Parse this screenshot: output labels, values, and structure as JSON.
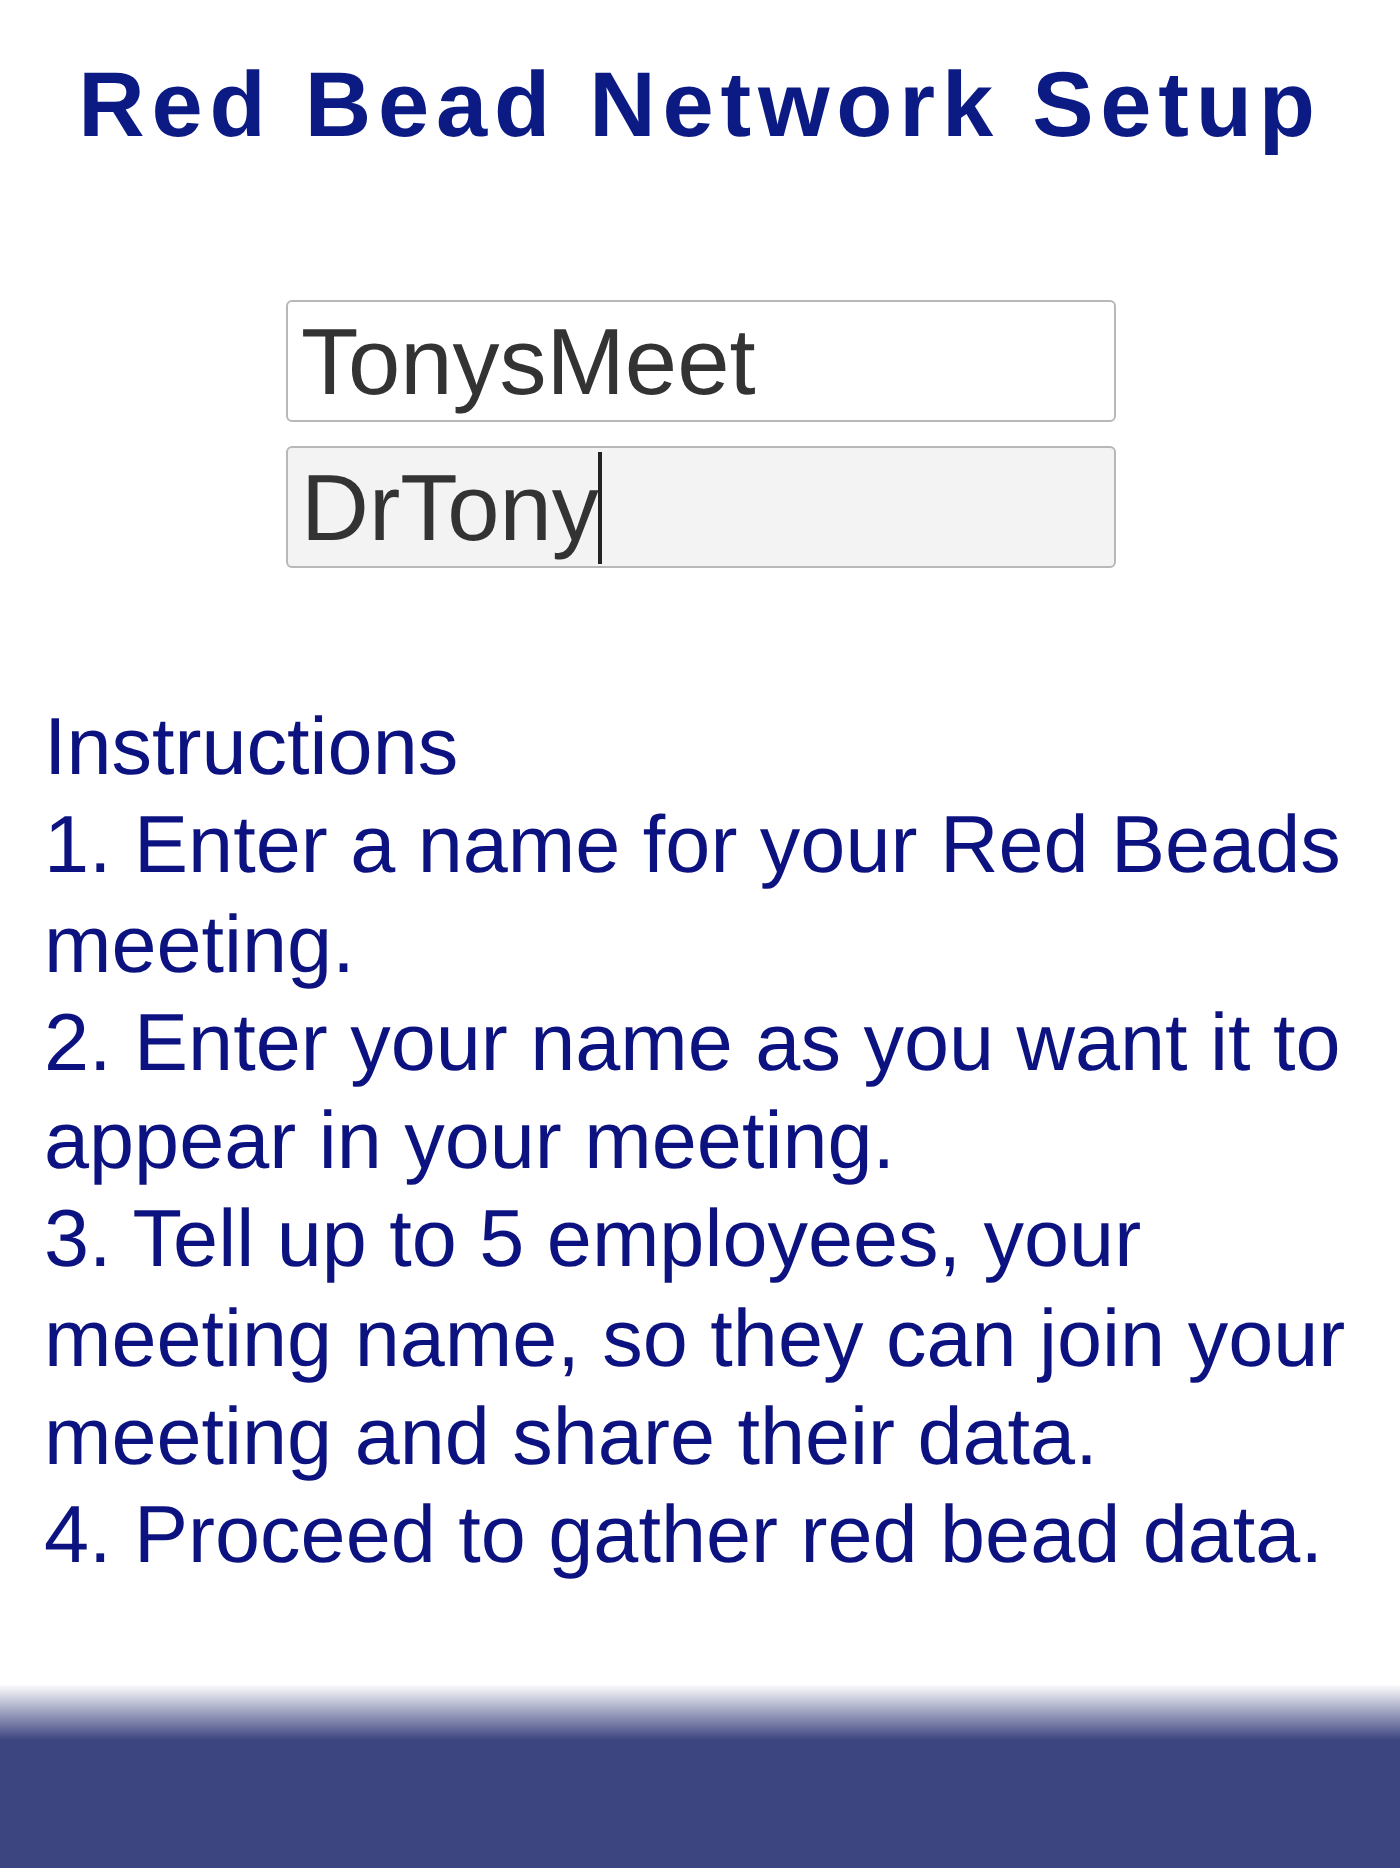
{
  "title": "Red Bead Network Setup",
  "fields": [
    {
      "value": "TonysMeet",
      "focused": false
    },
    {
      "value": "DrTony",
      "focused": true
    }
  ],
  "instructions": {
    "heading": "Instructions",
    "steps": [
      "1. Enter a name for your Red Beads meeting.",
      "2. Enter your name as you want it to appear in your meeting.",
      "3. Tell up to 5 employees, your meeting name, so they can join your meeting and share their data.",
      "4. Proceed to gather red bead data."
    ]
  }
}
